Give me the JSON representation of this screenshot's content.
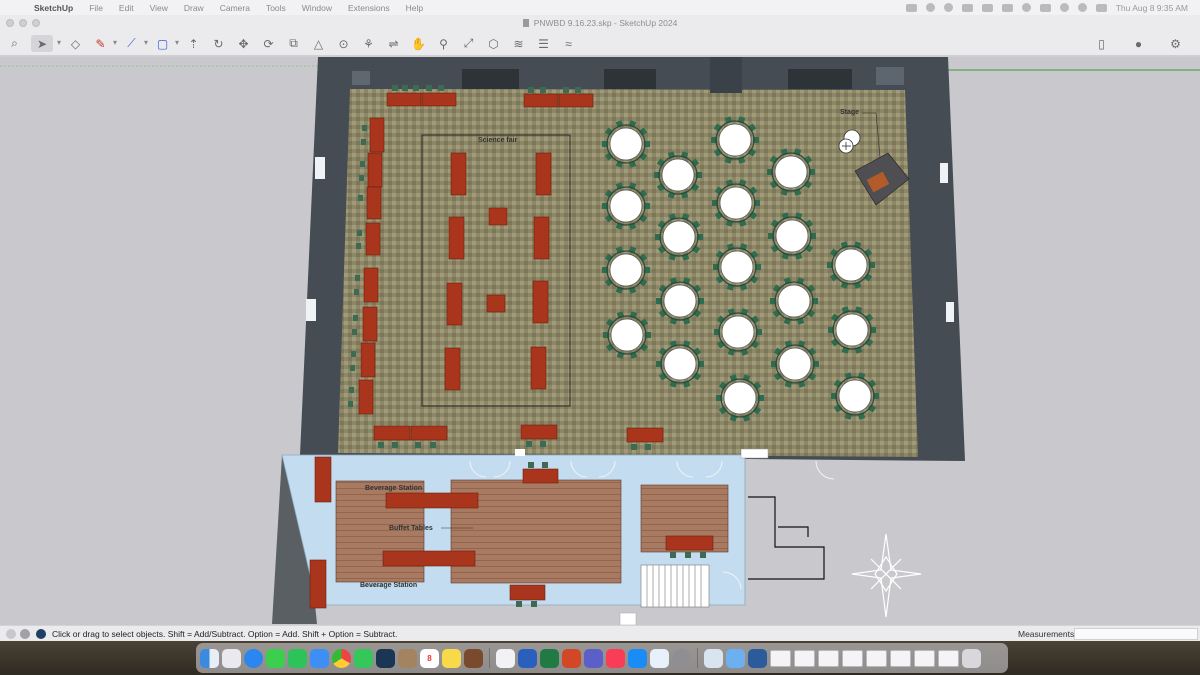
{
  "menubar": {
    "app_name": "SketchUp",
    "items": [
      "File",
      "Edit",
      "View",
      "Draw",
      "Camera",
      "Tools",
      "Window",
      "Extensions",
      "Help"
    ],
    "clock": "Thu Aug 8  9:35 AM"
  },
  "window": {
    "title": "PNWBD 9.16.23.skp - SketchUp 2024"
  },
  "toolbar": {
    "tools": [
      "search-icon",
      "select-icon",
      "eraser-icon",
      "pencil-icon",
      "line-icon",
      "rectangle-icon",
      "push-pull-icon",
      "follow-me-icon",
      "move-icon",
      "rotate-icon",
      "scale-icon",
      "tape-measure-icon",
      "text-icon",
      "paint-bucket-icon",
      "orbit-icon",
      "pan-icon",
      "zoom-icon",
      "zoom-extents-icon",
      "components-icon",
      "materials-icon",
      "layers-icon",
      "styles-icon"
    ],
    "right_tools": [
      "document-icon",
      "account-icon",
      "settings-icon"
    ]
  },
  "drawing": {
    "labels": {
      "science_fair": "Science fair",
      "stage": "Stage",
      "beverage_station_top": "Beverage Station",
      "buffet_tables": "Buffet Tables",
      "beverage_station_bottom": "Beverage Station"
    },
    "colors": {
      "background": "#c9c9cd",
      "wall": "#4a5159",
      "carpet": "#8f8867",
      "table_red": "#a8351c",
      "round_table": "#ffffff",
      "chair_green": "#2f6b4e",
      "lower_floor": "#c3dcef",
      "wood_floor": "#a4755f"
    }
  },
  "statusbar": {
    "hint": "Click or drag to select objects. Shift = Add/Subtract. Option = Add. Shift + Option = Subtract.",
    "measurements_label": "Measurements",
    "measurements_value": ""
  },
  "dock": {
    "calendar_day": "8",
    "apps": [
      "finder-icon",
      "launchpad-icon",
      "safari-icon",
      "messages-icon",
      "facetime-icon",
      "mail-icon",
      "chrome-icon",
      "facetime-video-icon",
      "sketchup-icon",
      "contacts-icon",
      "calendar-icon",
      "notes-icon",
      "game-icon",
      "freeform-icon",
      "word-icon",
      "excel-icon",
      "powerpoint-icon",
      "teams-icon",
      "music-icon",
      "app-store-icon",
      "meta-icon",
      "settings-icon",
      "preview-icon",
      "folder-icon",
      "vpn-icon"
    ]
  }
}
